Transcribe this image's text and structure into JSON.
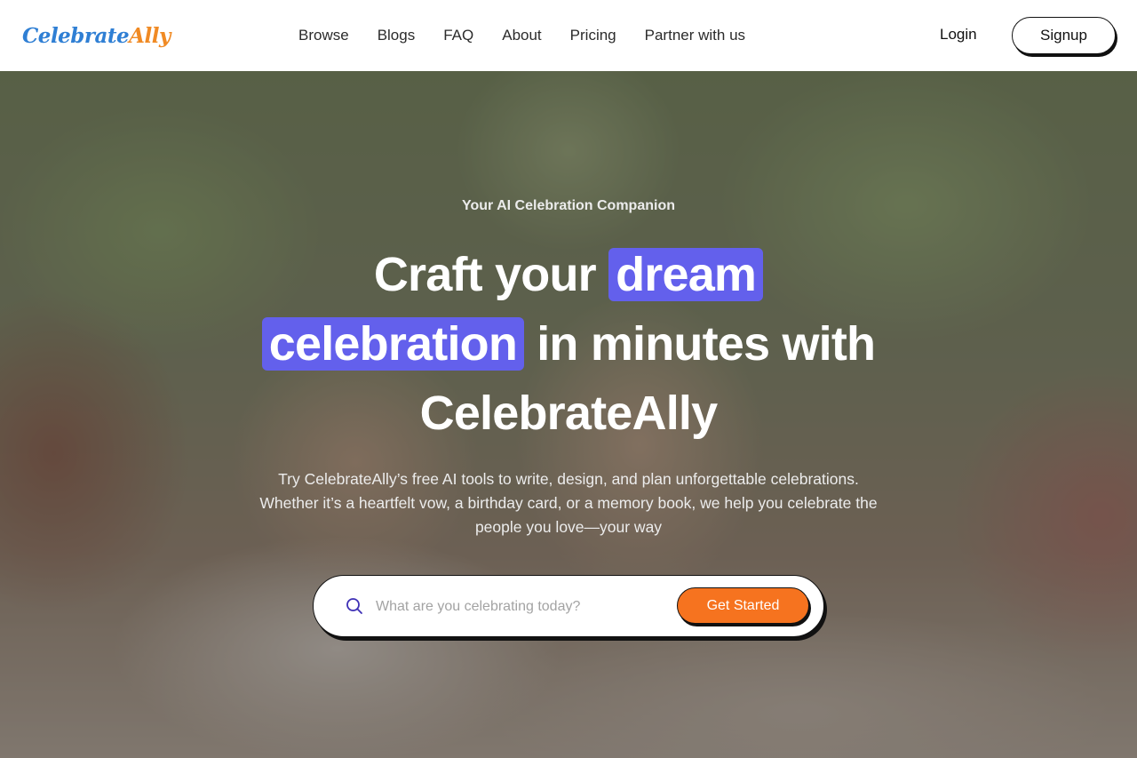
{
  "brand": {
    "logo_part1": "Celebrate",
    "logo_part2": "Ally"
  },
  "nav": {
    "items": [
      {
        "label": "Browse"
      },
      {
        "label": "Blogs"
      },
      {
        "label": "FAQ"
      },
      {
        "label": "About"
      },
      {
        "label": "Pricing"
      },
      {
        "label": "Partner with us"
      }
    ],
    "login_label": "Login",
    "signup_label": "Signup"
  },
  "hero": {
    "eyebrow": "Your AI Celebration Companion",
    "headline": {
      "line1_a": "Craft your ",
      "line1_highlight": "dream",
      "line2_highlight": "celebration",
      "line2_b": " in minutes with",
      "line3": "CelebrateAlly"
    },
    "subtext": "Try CelebrateAlly’s free AI tools to write, design, and plan unforgettable celebrations. Whether it’s a heartfelt vow, a birthday card, or a memory book, we help you celebrate the people you love—your way",
    "search": {
      "placeholder": "What are you celebrating today?",
      "value": "",
      "icon": "search-icon",
      "cta_label": "Get Started"
    }
  },
  "colors": {
    "highlight": "#6360ec",
    "cta": "#f6731f",
    "logo_blue": "#2f7fd4",
    "logo_orange": "#f08a24"
  }
}
